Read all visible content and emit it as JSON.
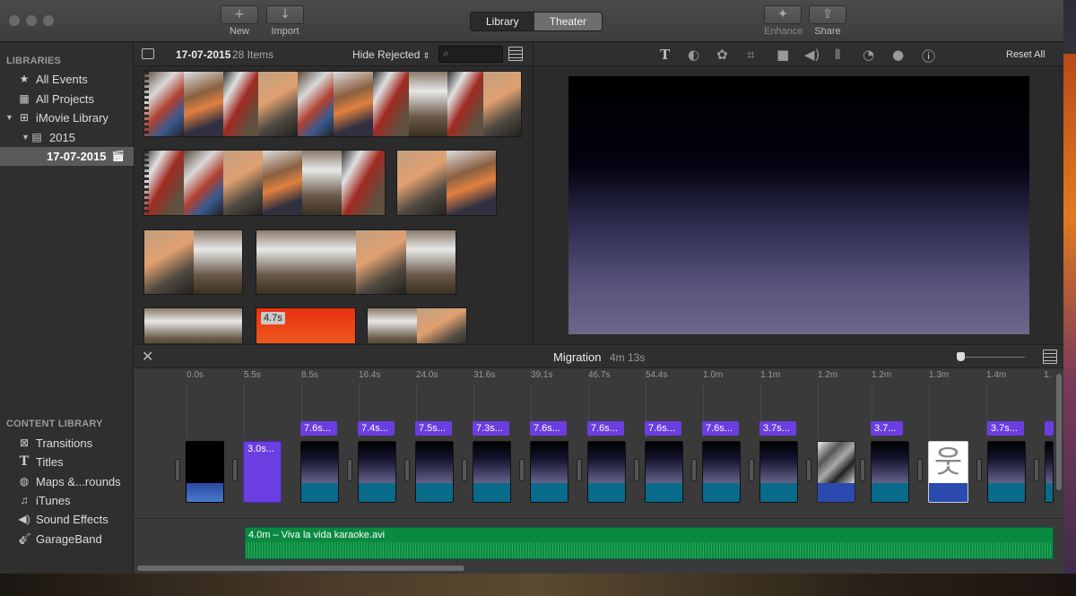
{
  "window": {
    "toolbar": {
      "new_label": "New",
      "new_icon": "+",
      "import_label": "Import",
      "import_icon": "↓",
      "library_tab": "Library",
      "theater_tab": "Theater",
      "enhance_label": "Enhance",
      "share_label": "Share"
    }
  },
  "sidebar": {
    "libraries_header": "LIBRARIES",
    "items": [
      {
        "label": "All Events",
        "icon": "star-icon"
      },
      {
        "label": "All Projects",
        "icon": "grid-icon"
      },
      {
        "label": "iMovie Library",
        "icon": "grid-icon"
      },
      {
        "label": "2015",
        "icon": "film-icon"
      },
      {
        "label": "17-07-2015",
        "icon": "clapper-icon"
      }
    ],
    "content_header": "CONTENT LIBRARY",
    "content_items": [
      {
        "label": "Transitions"
      },
      {
        "label": "Titles"
      },
      {
        "label": "Maps &...rounds"
      },
      {
        "label": "iTunes"
      },
      {
        "label": "Sound Effects"
      },
      {
        "label": "GarageBand"
      }
    ]
  },
  "browser": {
    "event_name": "17-07-2015",
    "item_count": "28 Items",
    "filter": "Hide Rejected",
    "clip_duration": "4.7s"
  },
  "viewer": {
    "reset_label": "Reset All",
    "adjust_icons": [
      "title-icon",
      "color-balance-icon",
      "color-palette-icon",
      "crop-icon",
      "stabilization-icon",
      "volume-icon",
      "equalizer-icon",
      "speed-icon",
      "noise-icon",
      "info-icon"
    ]
  },
  "timeline": {
    "project_name": "Migration",
    "project_duration": "4m 13s",
    "ticks": [
      "0.0s",
      "5.5s",
      "8.5s",
      "16.4s",
      "24.0s",
      "31.6s",
      "39.1s",
      "46.7s",
      "54.4s",
      "1.0m",
      "1.1m",
      "1.2m",
      "1.2m",
      "1.3m",
      "1.4m",
      "1."
    ],
    "titles": [
      "3.0s...",
      "7.6s...",
      "7.4s...",
      "7.5s...",
      "7.3s...",
      "7.6s...",
      "7.6s...",
      "7.6s...",
      "7.6s...",
      "3.7s...",
      "3.7...",
      "3.7s..."
    ],
    "audio_label": "4.0m – Viva la vida karaoke.avi"
  }
}
